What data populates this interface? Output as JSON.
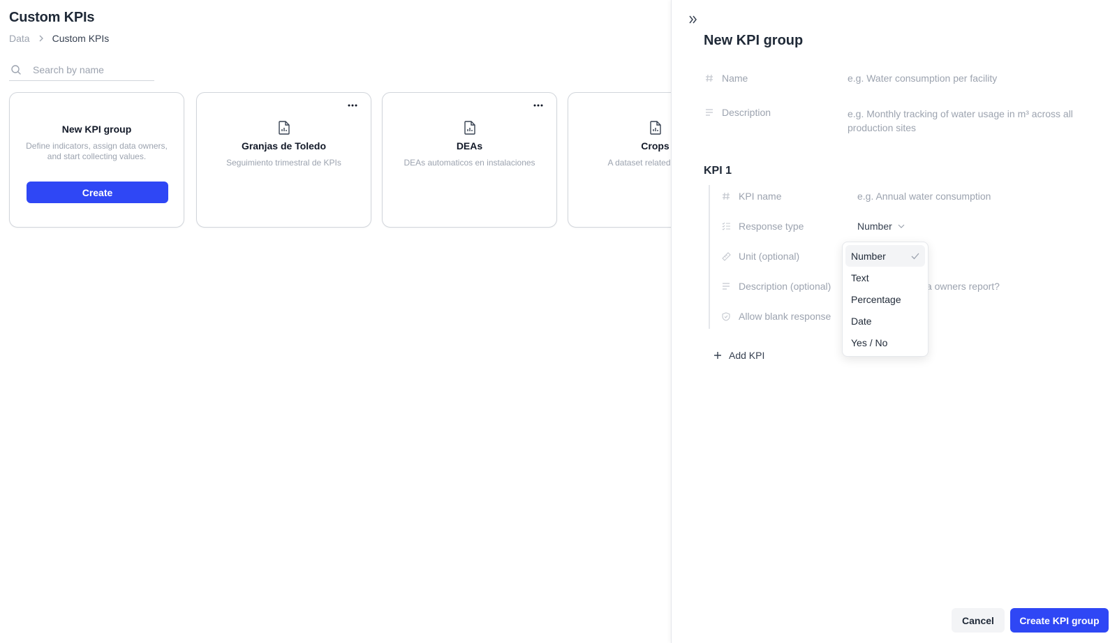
{
  "colors": {
    "accent": "#2f47f5",
    "muted_text": "#9ca3af",
    "border": "#d1d5db"
  },
  "header": {
    "title": "Custom KPIs",
    "breadcrumb": {
      "root": "Data",
      "current": "Custom KPIs"
    }
  },
  "search": {
    "placeholder": "Search by name",
    "value": ""
  },
  "new_group_card": {
    "title": "New KPI group",
    "description": "Define indicators, assign data owners, and start collecting values.",
    "button_label": "Create"
  },
  "datasets": [
    {
      "title": "Granjas de Toledo",
      "description": "Seguimiento trimestral de KPIs"
    },
    {
      "title": "DEAs",
      "description": "DEAs automaticos en instalaciones"
    },
    {
      "title": "Crops",
      "description": "A dataset related to crops"
    }
  ],
  "drawer": {
    "title": "New KPI group",
    "name_label": "Name",
    "name_placeholder": "e.g. Water consumption per facility",
    "description_label": "Description",
    "description_placeholder": "e.g. Monthly tracking of water usage in m³ across all production sites",
    "kpi_heading": "KPI 1",
    "kpi": {
      "name_label": "KPI name",
      "name_placeholder": "e.g. Annual water consumption",
      "response_type_label": "Response type",
      "response_type_value": "Number",
      "unit_label": "Unit (optional)",
      "description_label": "Description (optional)",
      "description_partial_placeholder": "ta owners report?",
      "allow_blank_label": "Allow blank response"
    },
    "add_kpi_label": "Add KPI",
    "cancel_label": "Cancel",
    "submit_label": "Create KPI group"
  },
  "response_type_dropdown": {
    "options": [
      "Number",
      "Text",
      "Percentage",
      "Date",
      "Yes / No"
    ],
    "selected": "Number"
  }
}
